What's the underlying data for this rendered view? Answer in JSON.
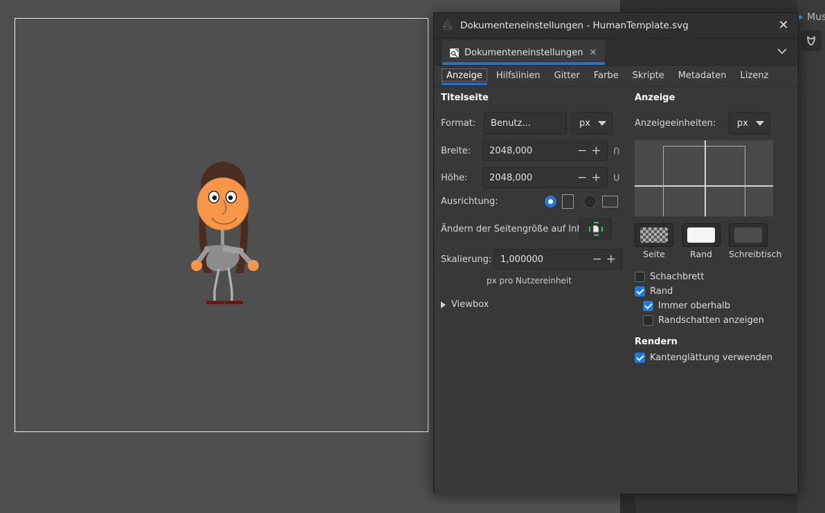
{
  "window": {
    "title": "Dokumenteneinstellungen - HumanTemplate.svg",
    "close_label": "✕",
    "app_icon": "inkscape-logo-icon"
  },
  "dock_tab": {
    "label": "Dokumenteneinstellungen",
    "close_label": "✕",
    "chevron": "chevron-down-icon"
  },
  "subtabs": [
    {
      "label": "Anzeige",
      "active": true
    },
    {
      "label": "Hilfslinien",
      "active": false
    },
    {
      "label": "Gitter",
      "active": false
    },
    {
      "label": "Farbe",
      "active": false
    },
    {
      "label": "Skripte",
      "active": false
    },
    {
      "label": "Metadaten",
      "active": false
    },
    {
      "label": "Lizenz",
      "active": false
    }
  ],
  "page_section": {
    "heading": "Titelseite",
    "format_label": "Format:",
    "format_value": "Benutz...",
    "format_unit": "px",
    "width_label": "Breite:",
    "width_value": "2048,000",
    "height_label": "Höhe:",
    "height_value": "2048,000",
    "orientation_label": "Ausrichtung:",
    "orientation_selected": "portrait",
    "resize_label": "Ändern der Seitengröße auf Inhalt:",
    "scale_label": "Skalierung:",
    "scale_value": "1,000000",
    "scale_hint": "px pro Nutzereinheit",
    "viewbox_label": "Viewbox",
    "minus": "−",
    "plus": "+"
  },
  "display_section": {
    "heading": "Anzeige",
    "units_label": "Anzeigeeinheiten:",
    "units_value": "px",
    "swatches": [
      {
        "label": "Seite",
        "kind": "checker"
      },
      {
        "label": "Rand",
        "kind": "white",
        "color": "#f6f6f6"
      },
      {
        "label": "Schreibtisch",
        "kind": "desk",
        "color": "#4c4c4c"
      }
    ],
    "checkboxes": [
      {
        "label": "Schachbrett",
        "checked": false,
        "indent": 0
      },
      {
        "label": "Rand",
        "checked": true,
        "indent": 0
      },
      {
        "label": "Immer oberhalb",
        "checked": true,
        "indent": 1
      },
      {
        "label": "Randschatten anzeigen",
        "checked": false,
        "indent": 1
      }
    ],
    "render_heading": "Rendern",
    "render_checkbox": {
      "label": "Kantenglättung verwenden",
      "checked": true
    }
  },
  "annotation": {
    "color": "#2222ee",
    "shape": "hand-drawn-ellipse"
  },
  "background": {
    "musterbar_label": "Mus",
    "accent_color": "#1a6fc4"
  },
  "canvas": {
    "page_border_color": "#f2f2f2",
    "desk_color": "#4f4f4f",
    "figure": {
      "skin_color": "#f79548",
      "hair_color": "#4a2c20",
      "body_color": "#8c8c8c",
      "shoe_color": "#7a1111"
    }
  }
}
